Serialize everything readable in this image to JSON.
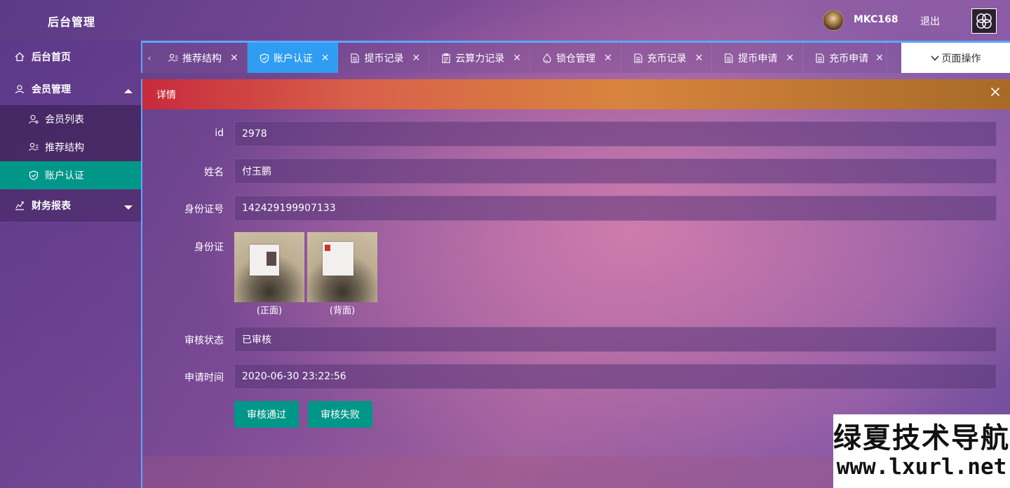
{
  "app": {
    "title": "后台管理"
  },
  "header": {
    "username": "MKC168",
    "logout_label": "退出"
  },
  "sidebar": {
    "items": [
      {
        "label": "后台首页",
        "icon": "home-icon"
      },
      {
        "label": "会员管理",
        "icon": "user-icon",
        "expanded": true,
        "children": [
          {
            "label": "会员列表",
            "icon": "person-icon"
          },
          {
            "label": "推荐结构",
            "icon": "org-icon"
          },
          {
            "label": "账户认证",
            "icon": "shield-icon",
            "active": true
          }
        ]
      },
      {
        "label": "财务报表",
        "icon": "chart-icon",
        "expanded": false
      }
    ]
  },
  "tabs": [
    {
      "label": "推荐结构",
      "icon": "org-icon"
    },
    {
      "label": "账户认证",
      "icon": "shield-icon",
      "active": true
    },
    {
      "label": "提币记录",
      "icon": "doc-icon"
    },
    {
      "label": "云算力记录",
      "icon": "clipboard-icon"
    },
    {
      "label": "锁仓管理",
      "icon": "drop-icon"
    },
    {
      "label": "充币记录",
      "icon": "doc-icon"
    },
    {
      "label": "提币申请",
      "icon": "doc-icon"
    },
    {
      "label": "充币申请",
      "icon": "doc-icon"
    }
  ],
  "page_ops_label": "页面操作",
  "detail": {
    "title": "详情",
    "fields": {
      "id_label": "id",
      "id_value": "2978",
      "name_label": "姓名",
      "name_value": "付玉鹏",
      "idno_label": "身份证号",
      "idno_value": "142429199907133",
      "idcard_label": "身份证",
      "front_caption": "(正面)",
      "back_caption": "(背面)",
      "status_label": "审核状态",
      "status_value": "已审核",
      "time_label": "申请时间",
      "time_value": "2020-06-30 23:22:56"
    },
    "approve_label": "审核通过",
    "reject_label": "审核失败"
  },
  "watermark": {
    "line1": "绿夏技术导航",
    "line2": "www.lxurl.net"
  },
  "colors": {
    "accent": "#009688",
    "tab_active": "#2f9df2",
    "tab_border": "#5aa8ff"
  }
}
